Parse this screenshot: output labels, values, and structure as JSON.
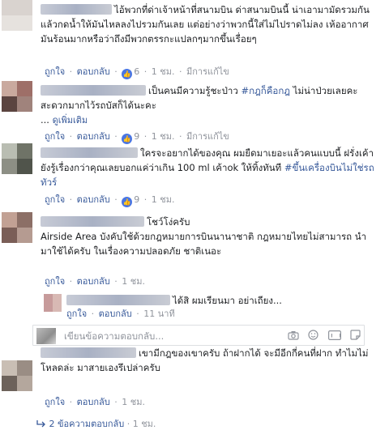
{
  "comments": [
    {
      "text": "ไอ้พวกที่ด่าเจ้าหน้าที่สนามบิน ด่าสนามบินนี้ น่าเอามามัดรวมกันแล้วกดน้ำให้มันไหลลงไปรวมกันเลย แต่อย่างว่าพวกนี้ใส่ไม่ไปราดไม่ลง เห้ออากาศมันร้อนมากหรือว่าถึงมีพวกตรรกะแปลกๆมากขึ้นเรื่อยๆ",
      "like_label": "ถูกใจ",
      "reply_label": "ตอบกลับ",
      "likes": "6",
      "time": "1 ชม.",
      "edited": "มีการแก้ไข"
    },
    {
      "text": "เป็นคนมีความรู้ชะป่าว ",
      "hashtag": "#กฎก็คือกฎ",
      "text_after": " ไม่น่าป่วยเลยคะ สะดวกมากไว้รถบัสก็ได้นะคะ",
      "more": "ดูเพิ่มเติม",
      "like_label": "ถูกใจ",
      "reply_label": "ตอบกลับ",
      "likes": "9",
      "time": "1 ชม.",
      "edited": "มีการแก้ไข"
    },
    {
      "text": "ใครจะอยากได้ของคุณ ผมยืดมาเยอะแล้วคนแบบนี้ ฝรั่งเค้ายังรู้เรื่องกว่าคุณเลยบอกแค่ว่าเกิน 100 ml เค้าok ให้ทิ้งทันที ",
      "hashtag": "#ขึ้นเครื่องบินไม่ใช่รถทัวร์",
      "like_label": "ถูกใจ",
      "reply_label": "ตอบกลับ",
      "likes": "9",
      "time": "1 ชม."
    },
    {
      "text_first": "โชว์โง่ครับ",
      "text": "Airside Area บังคับใช้ด้วยกฎหมายการบินนานาชาติ กฎหมายไทยไม่สามารถ นำมาใช้ได้ครับ ในเรื่องความปลอดภัย ชาติเนอะ",
      "like_label": "ถูกใจ",
      "reply_label": "ตอบกลับ",
      "time": "1 ชม."
    },
    {
      "text": "เขามีกฎของเขาครับ ถ้าฝากได้ จะมีอีกกี่คนที่ฝาก ทำไมไม่โหลดล่ะ มาสายเองรึเปล่าครับ",
      "like_label": "ถูกใจ",
      "reply_label": "ตอบกลับ",
      "time": "1 ชม."
    }
  ],
  "reply": {
    "text": "ได้สิ ผมเรียนมา อย่าเถียง...",
    "like_label": "ถูกใจ",
    "reply_label": "ตอบกลับ",
    "time": "11 นาที"
  },
  "reply_composer": {
    "placeholder": "เขียนข้อความตอบกลับ...",
    "icons": [
      "camera-icon",
      "emoji-icon",
      "gif-icon",
      "sticker-icon"
    ]
  },
  "view_replies": {
    "label": "2 ข้อความตอบกลับ",
    "time": "1 ชม."
  },
  "colors": {
    "link": "#365899",
    "meta": "#90949c",
    "like_badge": "#4a76e3"
  }
}
